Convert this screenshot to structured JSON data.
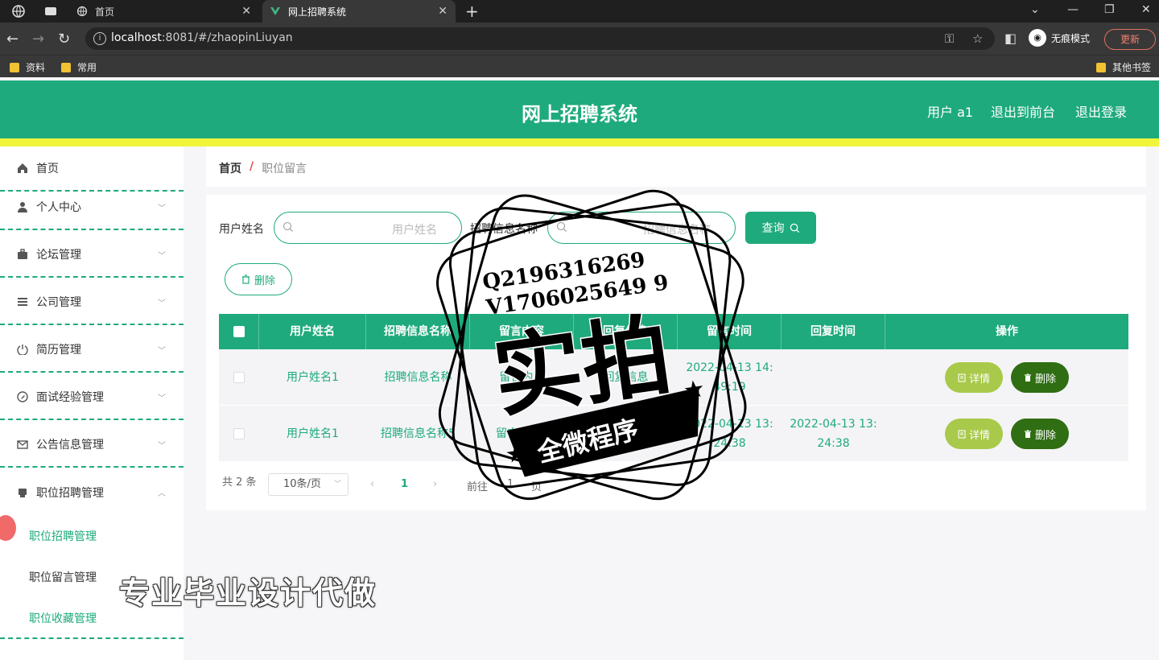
{
  "browser": {
    "tabs": [
      {
        "label": "首页"
      },
      {
        "label": "网上招聘系统"
      }
    ],
    "url_host": "localhost",
    "url_rest": ":8081/#/zhaopinLiuyan",
    "profile_label": "无痕模式",
    "update_label": "更新",
    "bookmarks": [
      {
        "label": "资料"
      },
      {
        "label": "常用"
      },
      {
        "label": "其他书签"
      }
    ]
  },
  "header": {
    "title": "网上招聘系统",
    "user": "用户 a1",
    "back_front": "退出到前台",
    "logout": "退出登录"
  },
  "sidebar": {
    "items": [
      {
        "label": "首页",
        "icon": "home-icon"
      },
      {
        "label": "个人中心",
        "icon": "user-icon"
      },
      {
        "label": "论坛管理",
        "icon": "briefcase-icon"
      },
      {
        "label": "公司管理",
        "icon": "list-icon"
      },
      {
        "label": "简历管理",
        "icon": "power-icon"
      },
      {
        "label": "面试经验管理",
        "icon": "compass-icon"
      },
      {
        "label": "公告信息管理",
        "icon": "mail-icon"
      },
      {
        "label": "职位招聘管理",
        "icon": "printer-icon"
      }
    ],
    "subitems": [
      {
        "label": "职位招聘管理"
      },
      {
        "label": "职位留言管理"
      },
      {
        "label": "职位收藏管理"
      }
    ]
  },
  "breadcrumb": {
    "home": "首页",
    "separator": "/",
    "current": "职位留言"
  },
  "search": {
    "field1_label": "用户姓名",
    "field1_placeholder": "用户姓名",
    "field2_label": "招聘信息名称",
    "field2_placeholder": "招聘信息名称",
    "query_label": "查询",
    "delete_label": "删除"
  },
  "table": {
    "headers": [
      "用户姓名",
      "招聘信息名称",
      "留言内容",
      "回复信息",
      "留言时间",
      "回复时间",
      "操作"
    ],
    "rows": [
      {
        "user": "用户姓名1",
        "job": "招聘信息名称",
        "content": "留言内容",
        "reply": "回复信息",
        "time1": "2022-04-13 14:",
        "time2": "49:19",
        "rtime1": "",
        "rtime2": ""
      },
      {
        "user": "用户姓名1",
        "job": "招聘信息名称5",
        "content": "留言内容5",
        "reply": "回复信息5",
        "time1": "2022-04-13 13:",
        "time2": "24:38",
        "rtime1": "2022-04-13 13:",
        "rtime2": "24:38"
      }
    ],
    "detail_label": "详情",
    "delete_label": "删除"
  },
  "pagination": {
    "total": "共 2 条",
    "page_size": "10条/页",
    "current_page": "1",
    "goto_prefix": "前往",
    "goto_value": "1",
    "goto_suffix": "页"
  },
  "watermark": {
    "qq": "Q2196316269",
    "vx": "V1706025649 9",
    "big": "实拍",
    "ribbon": "全微程序",
    "bottom_text": "专业毕业设计代做"
  },
  "colors": {
    "primary": "#1eaa7c",
    "header_strip": "#f0f53c",
    "detail_btn": "#a8c94a",
    "delete_btn": "#2f6e12"
  }
}
